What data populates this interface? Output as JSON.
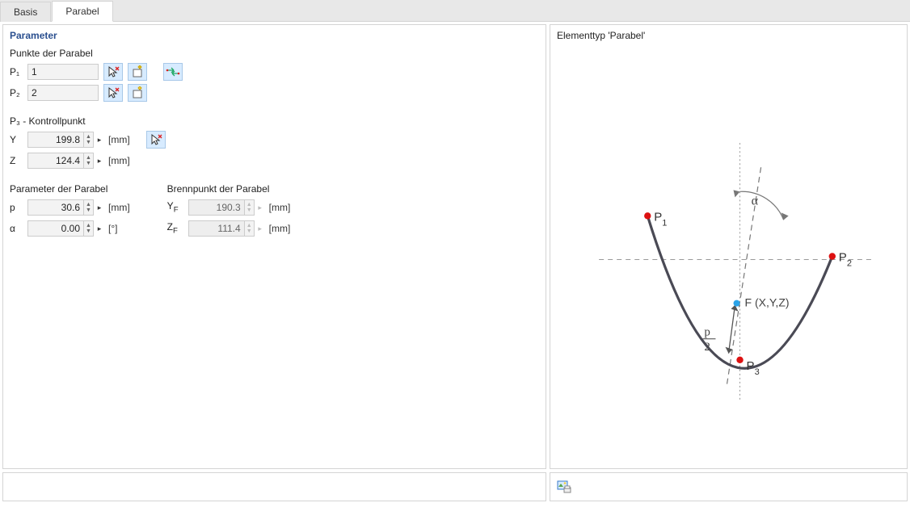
{
  "tabs": {
    "basis": "Basis",
    "parabel": "Parabel",
    "active": "parabel"
  },
  "panel": {
    "parameter_title": "Parameter",
    "points_header": "Punkte der Parabel",
    "p1_label": "P₁",
    "p1_value": "1",
    "p2_label": "P₂",
    "p2_value": "2",
    "p3_header": "P₃ - Kontrollpunkt",
    "y_label": "Y",
    "y_value": "199.8",
    "y_unit": "[mm]",
    "z_label": "Z",
    "z_value": "124.4",
    "z_unit": "[mm]",
    "param_header": "Parameter der Parabel",
    "p_label": "p",
    "p_value": "30.6",
    "p_unit": "[mm]",
    "alpha_label": "α",
    "alpha_value": "0.00",
    "alpha_unit": "[°]",
    "focus_header": "Brennpunkt der Parabel",
    "yf_label": "YF",
    "yf_value": "190.3",
    "yf_unit": "[mm]",
    "zf_label": "ZF",
    "zf_value": "111.4",
    "zf_unit": "[mm]"
  },
  "preview": {
    "title": "Elementtyp 'Parabel'",
    "labels": {
      "p1": "P₁",
      "p2": "P₂",
      "p3": "P₃",
      "focus": "F (X,Y,Z)",
      "alpha": "α",
      "half_p": "p/2"
    }
  }
}
